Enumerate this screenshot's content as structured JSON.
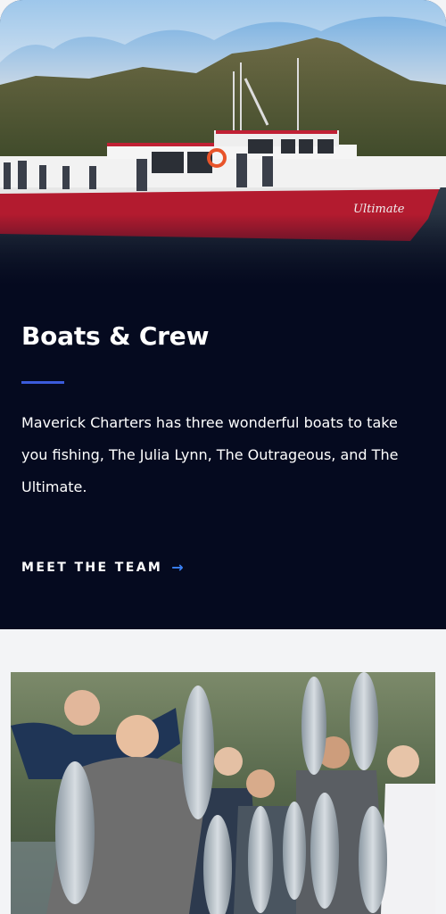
{
  "hero": {
    "image_alt": "Boat Ultimate near mountains",
    "boat_name": "Ultimate"
  },
  "section": {
    "title": "Boats & Crew",
    "description": "Maverick Charters has three wonderful boats to take you fishing, The Julia Lynn, The Outrageous, and The Ultimate.",
    "cta_label": "MEET THE TEAM",
    "cta_icon": "arrow-right-icon",
    "accent_color": "#3b5bdb",
    "background_color": "#050a1f"
  },
  "gallery": {
    "photo_alt": "Group of anglers holding salmon"
  }
}
